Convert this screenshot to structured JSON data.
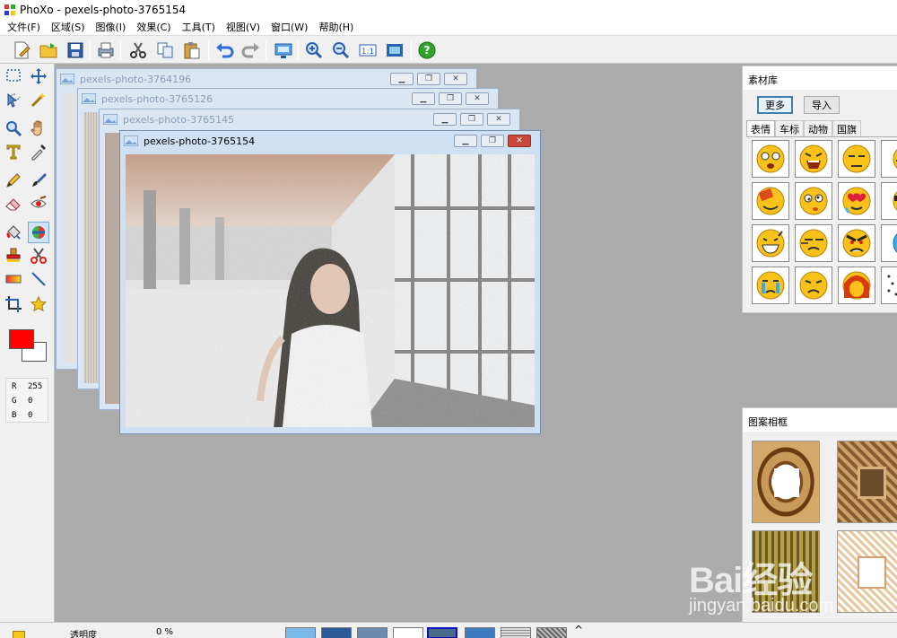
{
  "app": {
    "title": "PhoXo - pexels-photo-3765154"
  },
  "menu": [
    "文件(F)",
    "区域(S)",
    "图像(I)",
    "效果(C)",
    "工具(T)",
    "视图(V)",
    "窗口(W)",
    "帮助(H)"
  ],
  "toolbar_icons": [
    "new-icon",
    "open-icon",
    "save-icon",
    "print-icon",
    "cut-icon",
    "copy-icon",
    "paste-icon",
    "undo-icon",
    "redo-icon",
    "screen-capture-icon",
    "zoom-in-icon",
    "zoom-out-icon",
    "actual-size-icon",
    "fit-window-icon",
    "help-icon"
  ],
  "tools": [
    "rect-select-icon",
    "move-icon",
    "lasso-icon",
    "magic-wand-icon",
    "zoom-icon",
    "hand-icon",
    "text-icon",
    "eyedropper-icon",
    "pencil-icon",
    "brush-icon",
    "eraser-icon",
    "redeye-icon",
    "fill-icon",
    "color-replace-icon",
    "stamp-icon",
    "scissors-icon",
    "gradient-icon",
    "line-icon",
    "crop-icon",
    "star-shape-icon"
  ],
  "colors": {
    "foreground": "#ff0000",
    "background": "#ffffff",
    "accent": "#3c7fb1",
    "workspace": "#ababab"
  },
  "rgb": {
    "r_label": "R",
    "r": "255",
    "g_label": "G",
    "g": "0",
    "b_label": "B",
    "b": "0"
  },
  "windows": [
    {
      "title": "pexels-photo-3764196"
    },
    {
      "title": "pexels-photo-3765126"
    },
    {
      "title": "pexels-photo-3765145"
    },
    {
      "title": "pexels-photo-3765154"
    }
  ],
  "material_panel": {
    "title": "素材库",
    "more_button": "更多",
    "import_button": "导入",
    "tabs": [
      "表情",
      "车标",
      "动物",
      "国旗"
    ],
    "selected_tab": "表情"
  },
  "frame_panel": {
    "title": "图案相框"
  },
  "bottom": {
    "opacity_label": "透明度",
    "opacity_value": "0 %",
    "scroll_up": "^"
  },
  "watermark": {
    "brand": "Bai经验",
    "url": "jingyan.baidu.com"
  }
}
